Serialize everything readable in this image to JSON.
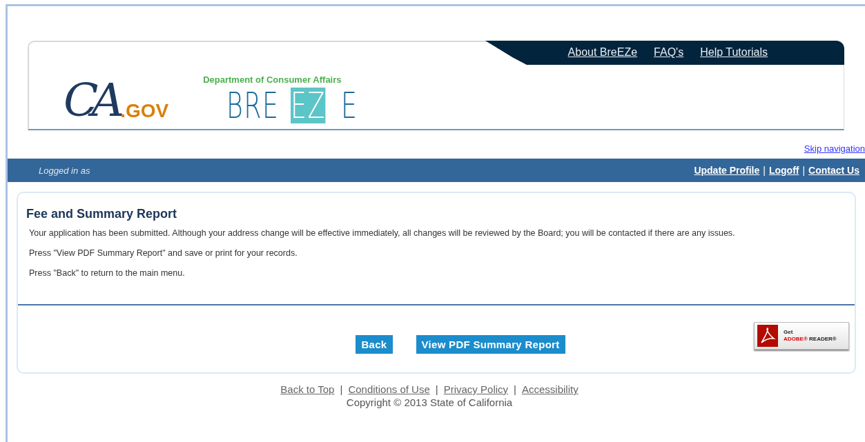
{
  "header": {
    "ca_logo": {
      "script": "CA",
      "suffix": ".GOV"
    },
    "agency": "Department of Consumer Affairs",
    "breeze_logo": [
      {
        "text": "BRE",
        "highlighted": false
      },
      {
        "text": "EZ",
        "highlighted": true
      },
      {
        "text": "E",
        "highlighted": false
      }
    ],
    "nav_links": [
      "About BreEZe",
      "FAQ's",
      "Help Tutorials"
    ]
  },
  "skip_link": "Skip navigation",
  "user_bar": {
    "logged_in": "Logged in as",
    "links": [
      "Update Profile",
      "Logoff",
      "Contact Us"
    ],
    "separator": "|"
  },
  "report": {
    "title": "Fee and Summary Report",
    "paragraphs": [
      "Your application has been submitted. Although your address change will be effective immediately, all changes will be reviewed by the Board; you will be contacted if there are any issues.",
      "Press \"View PDF Summary Report\" and save or print for your records.",
      "Press \"Back\" to return to the main menu."
    ],
    "buttons": [
      "Back",
      "View PDF Summary Report"
    ],
    "adobe_badge": {
      "line1": "Get",
      "brand": "ADOBE®",
      "product": "READER®"
    }
  },
  "footer": {
    "links": [
      "Back to Top",
      "Conditions of Use",
      "Privacy Policy",
      "Accessibility"
    ],
    "separator": "|",
    "copyright": "Copyright © 2013 State of California"
  }
}
